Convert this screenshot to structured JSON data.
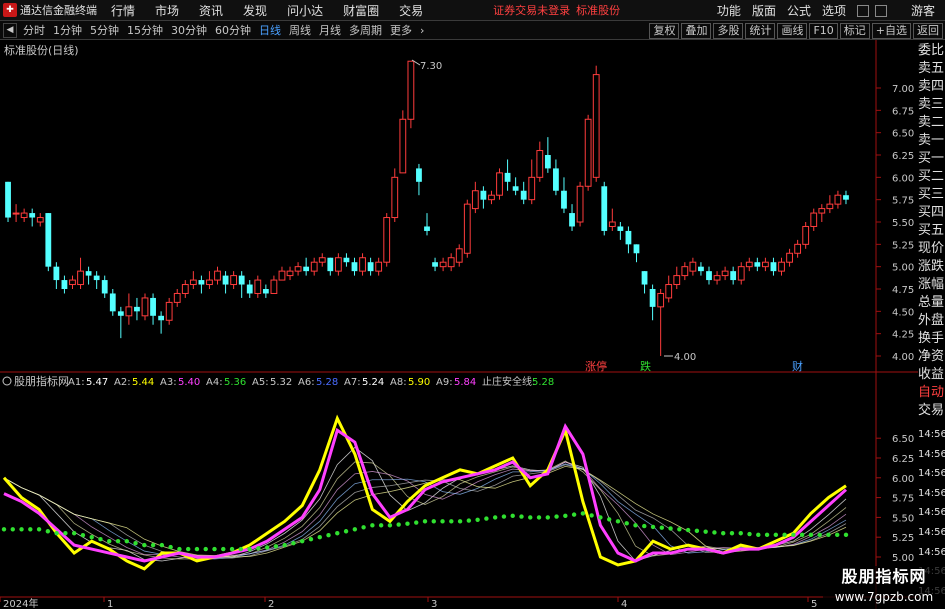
{
  "app": {
    "title": "通达信金融终端",
    "menu": [
      "行情",
      "市场",
      "资讯",
      "发现",
      "问小达",
      "财富圈",
      "交易"
    ],
    "notice": "证券交易未登录",
    "stock_notice": "标准股份",
    "right_menu": [
      "功能",
      "版面",
      "公式",
      "选项"
    ],
    "guest": "游客"
  },
  "toolbar": {
    "periods": [
      "分时",
      "1分钟",
      "5分钟",
      "15分钟",
      "30分钟",
      "60分钟",
      "日线",
      "周线",
      "月线",
      "多周期",
      "更多"
    ],
    "active_period": "日线",
    "right_buttons": [
      "复权",
      "叠加",
      "多股",
      "统计",
      "画线",
      "F10",
      "标记",
      "+自选",
      "返回"
    ]
  },
  "main_chart": {
    "title": "标准股份(日线)",
    "price_ticks": [
      "7.00",
      "6.75",
      "6.50",
      "6.25",
      "6.00",
      "5.75",
      "5.50",
      "5.25",
      "5.00",
      "4.75",
      "4.50",
      "4.25",
      "4.00"
    ],
    "high_label": "7.30",
    "low_label": "4.00",
    "markers": [
      {
        "text": "涨停",
        "color": "#ff4040"
      },
      {
        "text": "跌",
        "color": "#30e030"
      },
      {
        "text": "财",
        "color": "#4aa0ff"
      }
    ]
  },
  "indicator": {
    "name": "股朋指标网",
    "legend": [
      {
        "label": "A1:",
        "value": "5.47",
        "color": "#ffffff"
      },
      {
        "label": "A2:",
        "value": "5.44",
        "color": "#ffff00"
      },
      {
        "label": "A3:",
        "value": "5.40",
        "color": "#ff40ff"
      },
      {
        "label": "A4:",
        "value": "5.36",
        "color": "#30e030"
      },
      {
        "label": "A5:",
        "value": "5.32",
        "color": "#c8c8c8"
      },
      {
        "label": "A6:",
        "value": "5.28",
        "color": "#4a6cff"
      },
      {
        "label": "A7:",
        "value": "5.24",
        "color": "#ffffff"
      },
      {
        "label": "A8:",
        "value": "5.90",
        "color": "#ffff00"
      },
      {
        "label": "A9:",
        "value": "5.84",
        "color": "#ff40ff"
      },
      {
        "label": "止庄安全线:",
        "value": "5.28",
        "color": "#30e030"
      }
    ],
    "ticks": [
      "6.50",
      "6.25",
      "6.00",
      "5.75",
      "5.50",
      "5.25",
      "5.00"
    ]
  },
  "x_axis": [
    "2024年",
    "1",
    "2",
    "3",
    "4",
    "5"
  ],
  "quote_panel": {
    "labels": [
      "委比",
      "卖五",
      "卖四",
      "卖三",
      "卖二",
      "卖一",
      "买一",
      "买二",
      "买三",
      "买四",
      "买五",
      "现价",
      "涨跌",
      "涨幅",
      "总量",
      "外盘",
      "换手",
      "净资",
      "收益"
    ],
    "auto": "自动",
    "trade": "交易",
    "times": [
      "14:56",
      "14:56",
      "14:56",
      "14:56",
      "14:56",
      "14:56",
      "14:56",
      "14:56",
      "14:56"
    ]
  },
  "watermark": {
    "line1": "股朋指标网",
    "line2": "www.7gpzb.com"
  },
  "chart_data": {
    "type": "candlestick",
    "candles": [
      [
        5.95,
        5.55,
        5.95,
        5.5
      ],
      [
        5.6,
        5.6,
        5.7,
        5.5
      ],
      [
        5.55,
        5.6,
        5.65,
        5.5
      ],
      [
        5.6,
        5.55,
        5.65,
        5.45
      ],
      [
        5.5,
        5.55,
        5.6,
        5.45
      ],
      [
        5.6,
        5.0,
        5.6,
        4.95
      ],
      [
        5.0,
        4.85,
        5.05,
        4.75
      ],
      [
        4.85,
        4.75,
        4.9,
        4.7
      ],
      [
        4.8,
        4.85,
        4.9,
        4.75
      ],
      [
        4.8,
        4.95,
        5.1,
        4.75
      ],
      [
        4.95,
        4.9,
        5.0,
        4.8
      ],
      [
        4.9,
        4.85,
        4.95,
        4.75
      ],
      [
        4.85,
        4.7,
        4.9,
        4.65
      ],
      [
        4.7,
        4.5,
        4.75,
        4.45
      ],
      [
        4.5,
        4.45,
        4.55,
        4.2
      ],
      [
        4.45,
        4.55,
        4.7,
        4.35
      ],
      [
        4.55,
        4.5,
        4.65,
        4.4
      ],
      [
        4.45,
        4.65,
        4.7,
        4.4
      ],
      [
        4.65,
        4.45,
        4.7,
        4.35
      ],
      [
        4.45,
        4.4,
        4.5,
        4.25
      ],
      [
        4.4,
        4.6,
        4.65,
        4.35
      ],
      [
        4.6,
        4.7,
        4.75,
        4.55
      ],
      [
        4.7,
        4.8,
        4.85,
        4.65
      ],
      [
        4.8,
        4.85,
        4.95,
        4.75
      ],
      [
        4.85,
        4.8,
        4.9,
        4.7
      ],
      [
        4.8,
        4.85,
        4.95,
        4.75
      ],
      [
        4.85,
        4.95,
        5.0,
        4.8
      ],
      [
        4.9,
        4.8,
        4.95,
        4.7
      ],
      [
        4.8,
        4.9,
        4.95,
        4.75
      ],
      [
        4.9,
        4.8,
        4.95,
        4.65
      ],
      [
        4.8,
        4.7,
        4.85,
        4.65
      ],
      [
        4.7,
        4.85,
        4.9,
        4.65
      ],
      [
        4.75,
        4.7,
        4.8,
        4.65
      ],
      [
        4.7,
        4.85,
        4.9,
        4.7
      ],
      [
        4.85,
        4.95,
        5.0,
        4.85
      ],
      [
        4.9,
        4.95,
        5.0,
        4.85
      ],
      [
        4.95,
        5.0,
        5.05,
        4.9
      ],
      [
        5.0,
        4.95,
        5.1,
        4.9
      ],
      [
        4.95,
        5.05,
        5.1,
        4.9
      ],
      [
        5.05,
        5.1,
        5.15,
        5.0
      ],
      [
        5.1,
        4.95,
        5.1,
        4.9
      ],
      [
        4.95,
        5.1,
        5.15,
        4.9
      ],
      [
        5.1,
        5.05,
        5.15,
        5.0
      ],
      [
        5.05,
        4.95,
        5.1,
        4.9
      ],
      [
        4.95,
        5.1,
        5.15,
        4.9
      ],
      [
        5.05,
        4.95,
        5.1,
        4.9
      ],
      [
        4.95,
        5.05,
        5.1,
        4.9
      ],
      [
        5.05,
        5.55,
        5.6,
        5.0
      ],
      [
        5.55,
        6.0,
        6.1,
        5.5
      ],
      [
        6.05,
        6.65,
        6.75,
        6.3
      ],
      [
        6.65,
        7.3,
        7.3,
        6.55
      ],
      [
        6.1,
        5.95,
        6.15,
        5.8
      ],
      [
        5.45,
        5.4,
        5.6,
        5.35
      ],
      [
        5.05,
        5.0,
        5.1,
        4.95
      ],
      [
        5.0,
        5.05,
        5.1,
        4.95
      ],
      [
        5.0,
        5.1,
        5.15,
        4.95
      ],
      [
        5.05,
        5.2,
        5.25,
        5.0
      ],
      [
        5.15,
        5.7,
        5.75,
        5.1
      ],
      [
        5.65,
        5.85,
        5.95,
        5.6
      ],
      [
        5.85,
        5.75,
        5.9,
        5.65
      ],
      [
        5.75,
        5.8,
        5.85,
        5.7
      ],
      [
        5.8,
        6.05,
        6.1,
        5.75
      ],
      [
        6.05,
        5.95,
        6.2,
        5.85
      ],
      [
        5.9,
        5.85,
        6.0,
        5.8
      ],
      [
        5.85,
        5.75,
        5.95,
        5.7
      ],
      [
        5.75,
        6.0,
        6.2,
        5.7
      ],
      [
        6.0,
        6.3,
        6.4,
        5.95
      ],
      [
        6.25,
        6.1,
        6.45,
        6.05
      ],
      [
        6.1,
        5.85,
        6.2,
        5.8
      ],
      [
        5.85,
        5.65,
        6.0,
        5.6
      ],
      [
        5.6,
        5.45,
        5.7,
        5.4
      ],
      [
        5.5,
        5.9,
        5.95,
        5.45
      ],
      [
        5.9,
        6.65,
        6.7,
        5.85
      ],
      [
        6.0,
        7.15,
        7.25,
        5.95
      ],
      [
        5.9,
        5.4,
        5.95,
        5.35
      ],
      [
        5.45,
        5.5,
        5.65,
        5.4
      ],
      [
        5.45,
        5.4,
        5.5,
        5.3
      ],
      [
        5.4,
        5.25,
        5.45,
        5.15
      ],
      [
        5.25,
        5.15,
        5.25,
        5.05
      ],
      [
        4.95,
        4.8,
        4.95,
        4.7
      ],
      [
        4.75,
        4.55,
        4.8,
        4.4
      ],
      [
        4.55,
        4.7,
        4.75,
        4.0
      ],
      [
        4.65,
        4.8,
        4.9,
        4.6
      ],
      [
        4.8,
        4.9,
        5.0,
        4.75
      ],
      [
        4.9,
        5.0,
        5.05,
        4.85
      ],
      [
        4.95,
        5.05,
        5.1,
        4.9
      ],
      [
        5.0,
        4.95,
        5.05,
        4.9
      ],
      [
        4.95,
        4.85,
        5.0,
        4.8
      ],
      [
        4.85,
        4.9,
        4.95,
        4.8
      ],
      [
        4.9,
        4.95,
        5.0,
        4.85
      ],
      [
        4.95,
        4.85,
        5.0,
        4.8
      ],
      [
        4.85,
        5.0,
        5.05,
        4.8
      ],
      [
        5.0,
        5.05,
        5.1,
        4.95
      ],
      [
        5.05,
        5.0,
        5.1,
        4.95
      ],
      [
        5.0,
        5.05,
        5.1,
        4.95
      ],
      [
        5.05,
        4.95,
        5.1,
        4.9
      ],
      [
        4.95,
        5.05,
        5.1,
        4.9
      ],
      [
        5.05,
        5.15,
        5.2,
        5.0
      ],
      [
        5.15,
        5.25,
        5.3,
        5.1
      ],
      [
        5.25,
        5.45,
        5.5,
        5.2
      ],
      [
        5.45,
        5.6,
        5.65,
        5.4
      ],
      [
        5.6,
        5.65,
        5.7,
        5.5
      ],
      [
        5.65,
        5.7,
        5.8,
        5.6
      ],
      [
        5.7,
        5.8,
        5.85,
        5.65
      ],
      [
        5.8,
        5.75,
        5.85,
        5.7
      ]
    ],
    "indicator_series": [
      {
        "name": "A8",
        "color": "#ffff00",
        "values": [
          6.0,
          5.75,
          5.6,
          5.3,
          5.05,
          5.2,
          5.1,
          4.95,
          4.85,
          5.05,
          5.05,
          4.95,
          5.0,
          5.05,
          5.15,
          5.3,
          5.45,
          5.65,
          6.1,
          6.75,
          6.3,
          5.6,
          5.45,
          5.7,
          5.9,
          6.0,
          6.1,
          6.05,
          6.15,
          6.25,
          5.9,
          6.1,
          6.6,
          5.7,
          5.0,
          4.9,
          4.95,
          5.2,
          5.1,
          5.15,
          5.1,
          5.05,
          5.15,
          5.1,
          5.2,
          5.3,
          5.55,
          5.75,
          5.9
        ]
      },
      {
        "name": "A9",
        "color": "#ff40ff",
        "values": [
          5.8,
          5.7,
          5.55,
          5.35,
          5.15,
          5.1,
          5.05,
          5.0,
          4.95,
          5.0,
          5.05,
          5.0,
          5.0,
          5.05,
          5.1,
          5.2,
          5.35,
          5.5,
          5.85,
          6.6,
          6.45,
          5.8,
          5.5,
          5.6,
          5.85,
          5.95,
          6.0,
          6.05,
          6.1,
          6.2,
          6.0,
          6.05,
          6.65,
          6.3,
          5.4,
          5.05,
          4.95,
          5.05,
          5.05,
          5.1,
          5.1,
          5.05,
          5.1,
          5.1,
          5.15,
          5.25,
          5.45,
          5.65,
          5.85
        ]
      },
      {
        "name": "止庄安全线",
        "color": "#30e030",
        "values": [
          5.35,
          5.35,
          5.35,
          5.3,
          5.3,
          5.25,
          5.2,
          5.2,
          5.15,
          5.15,
          5.1,
          5.1,
          5.1,
          5.1,
          5.1,
          5.12,
          5.15,
          5.2,
          5.25,
          5.3,
          5.35,
          5.4,
          5.4,
          5.42,
          5.45,
          5.45,
          5.45,
          5.47,
          5.5,
          5.52,
          5.5,
          5.5,
          5.52,
          5.55,
          5.5,
          5.45,
          5.4,
          5.38,
          5.36,
          5.34,
          5.32,
          5.3,
          5.3,
          5.28,
          5.28,
          5.28,
          5.28,
          5.28,
          5.28
        ]
      }
    ]
  }
}
